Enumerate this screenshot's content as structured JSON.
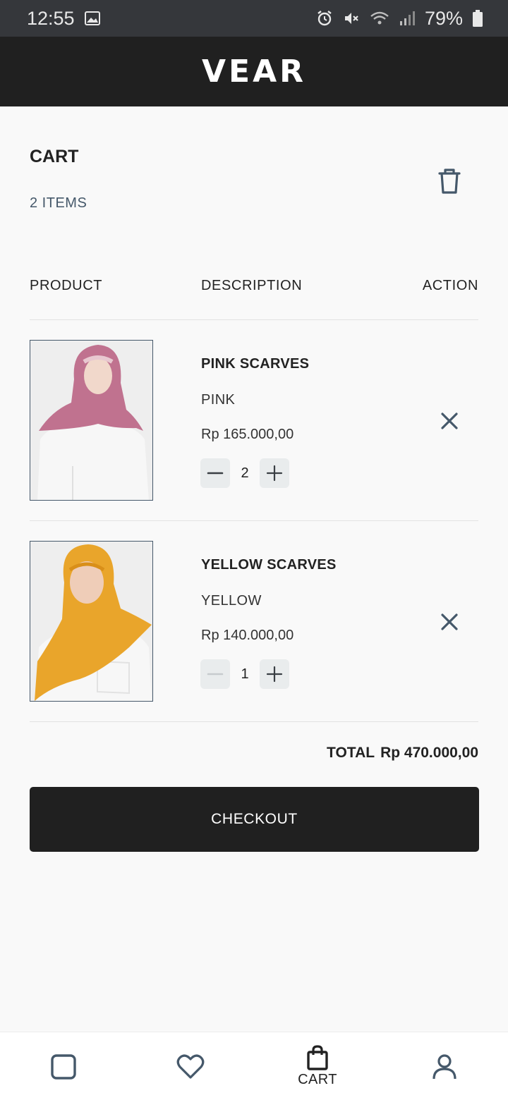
{
  "status_bar": {
    "time": "12:55",
    "battery": "79%",
    "icons": [
      "gallery-icon",
      "alarm-icon",
      "mute-icon",
      "wifi-icon",
      "signal-icon",
      "battery-icon"
    ]
  },
  "header": {
    "logo": "VEAR"
  },
  "cart": {
    "title": "CART",
    "item_count": "2 ITEMS"
  },
  "columns": {
    "product": "PRODUCT",
    "description": "DESCRIPTION",
    "action": "ACTION"
  },
  "items": [
    {
      "name": "PINK SCARVES",
      "color": "PINK",
      "price": "Rp 165.000,00",
      "quantity": "2",
      "scarf_color": "#c0728f"
    },
    {
      "name": "YELLOW SCARVES",
      "color": "YELLOW",
      "price": "Rp 140.000,00",
      "quantity": "1",
      "scarf_color": "#e9a52b"
    }
  ],
  "summary": {
    "total_label": "TOTAL",
    "total_value": "Rp 470.000,00"
  },
  "checkout": {
    "label": "CHECKOUT"
  },
  "bottom_nav": {
    "cart_label": "CART",
    "icons": [
      "home-icon",
      "heart-icon",
      "shopping-bag-icon",
      "user-icon"
    ]
  },
  "colors": {
    "dark": "#202020",
    "accent_text": "#45586a",
    "status_bar": "#35373b"
  }
}
